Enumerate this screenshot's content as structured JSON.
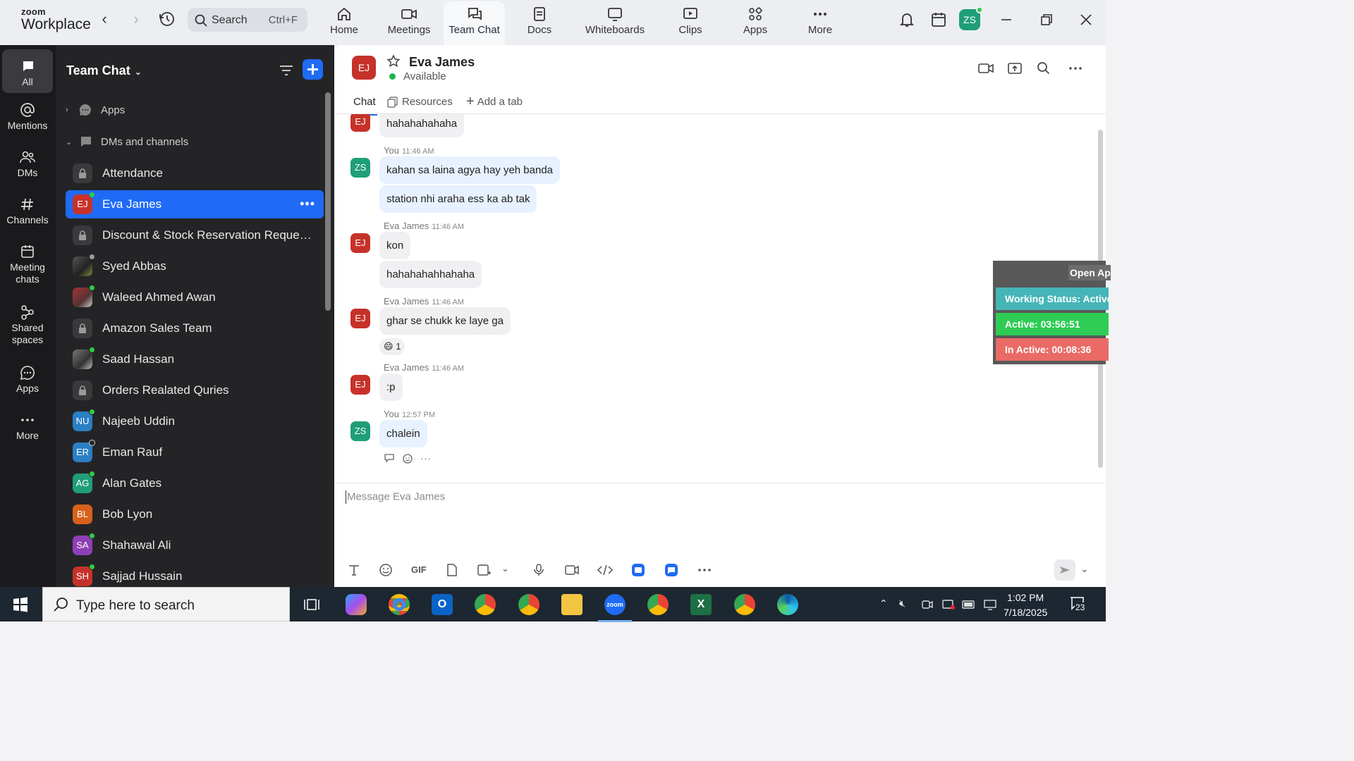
{
  "brand": {
    "line1": "zoom",
    "line2": "Workplace"
  },
  "search": {
    "placeholder": "Search",
    "shortcut": "Ctrl+F"
  },
  "nav_tabs": [
    {
      "label": "Home",
      "icon": "home-icon"
    },
    {
      "label": "Meetings",
      "icon": "video-camera-icon"
    },
    {
      "label": "Team Chat",
      "icon": "chat-bubbles-icon",
      "active": true
    },
    {
      "label": "Docs",
      "icon": "document-icon"
    },
    {
      "label": "Whiteboards",
      "icon": "whiteboard-icon"
    },
    {
      "label": "Clips",
      "icon": "clips-icon"
    },
    {
      "label": "Apps",
      "icon": "apps-grid-icon"
    },
    {
      "label": "More",
      "icon": "more-dots-icon"
    }
  ],
  "user": {
    "initials": "ZS"
  },
  "rail": [
    {
      "label": "All",
      "icon": "chat-icon",
      "active": true
    },
    {
      "label": "Mentions",
      "icon": "at-icon"
    },
    {
      "label": "DMs",
      "icon": "people-icon"
    },
    {
      "label": "Channels",
      "icon": "hash-icon"
    },
    {
      "label": "Meeting chats",
      "icon": "calendar-icon"
    },
    {
      "label": "Shared spaces",
      "icon": "shared-spaces-icon"
    },
    {
      "label": "Apps",
      "icon": "apps-chat-icon"
    },
    {
      "label": "More",
      "icon": "more-dots-icon"
    }
  ],
  "list": {
    "title": "Team Chat",
    "sections": {
      "apps": "Apps",
      "dms": "DMs and channels"
    },
    "items": [
      {
        "label": "Attendance",
        "type": "lock"
      },
      {
        "label": "Eva James",
        "initials": "EJ",
        "color": "#c6322a",
        "status": "#2ecc40",
        "selected": true
      },
      {
        "label": "Discount & Stock Reservation Requests O...",
        "type": "lock"
      },
      {
        "label": "Syed Abbas",
        "type": "photo",
        "status": "#9a9a9a"
      },
      {
        "label": "Waleed Ahmed Awan",
        "type": "photo",
        "status": "#2ecc40"
      },
      {
        "label": "Amazon Sales Team",
        "type": "lock"
      },
      {
        "label": "Saad Hassan",
        "type": "photo",
        "status": "#2ecc40"
      },
      {
        "label": "Orders Realated Quries",
        "type": "lock"
      },
      {
        "label": "Najeeb Uddin",
        "initials": "NU",
        "color": "#2b7fc4",
        "status": "#2ecc40"
      },
      {
        "label": "Eman Rauf",
        "initials": "ER",
        "color": "#2b7fc4",
        "status": "#cfcfcf"
      },
      {
        "label": "Alan Gates",
        "initials": "AG",
        "color": "#1f9e78",
        "status": "#2ecc40"
      },
      {
        "label": "Bob Lyon",
        "initials": "BL",
        "color": "#d8611b",
        "status": ""
      },
      {
        "label": "Shahawal Ali",
        "initials": "SA",
        "color": "#8e3fb5",
        "status": "#2ecc40"
      },
      {
        "label": "Sajjad Hussain",
        "initials": "SH",
        "color": "#c6322a",
        "status": "#2ecc40"
      }
    ]
  },
  "chat": {
    "contact": {
      "initials": "EJ",
      "name": "Eva James",
      "status": "Available"
    },
    "tabs": {
      "chat": "Chat",
      "resources": "Resources",
      "add": "Add a tab"
    },
    "messages": {
      "m0": {
        "text": "hahahahahaha",
        "initials": "EJ"
      },
      "g1": {
        "sender": "You",
        "time": "11:46 AM",
        "initials": "ZS",
        "line1": "kahan sa laina agya hay yeh banda",
        "line2": "station nhi araha ess ka ab tak"
      },
      "g2": {
        "sender": "Eva James",
        "time": "11:46 AM",
        "initials": "EJ",
        "line1": "kon",
        "line2": "hahahahahhahaha"
      },
      "g3": {
        "sender": "Eva James",
        "time": "11:46 AM",
        "initials": "EJ",
        "line1": "ghar se chukk ke laye ga",
        "reaction_emoji": "😄",
        "reaction_count": "1"
      },
      "g4": {
        "sender": "Eva James",
        "time": "11:46 AM",
        "initials": "EJ",
        "line1": ":p"
      },
      "g5": {
        "sender": "You",
        "time": "12:57 PM",
        "initials": "ZS",
        "line1": "chalein"
      }
    },
    "composer_placeholder": "Message Eva James",
    "composer_gif": "GIF"
  },
  "widget": {
    "open": "Open Ap",
    "working": "Working Status: Active",
    "active": "Active: 03:56:51",
    "inactive": "In Active: 00:08:36",
    "colors": {
      "working": "#45b5b8",
      "active": "#2ecc55",
      "inactive": "#ea6b66"
    }
  },
  "taskbar": {
    "search_placeholder": "Type here to search",
    "time": "1:02 PM",
    "date": "7/18/2025",
    "notifications": "23"
  }
}
